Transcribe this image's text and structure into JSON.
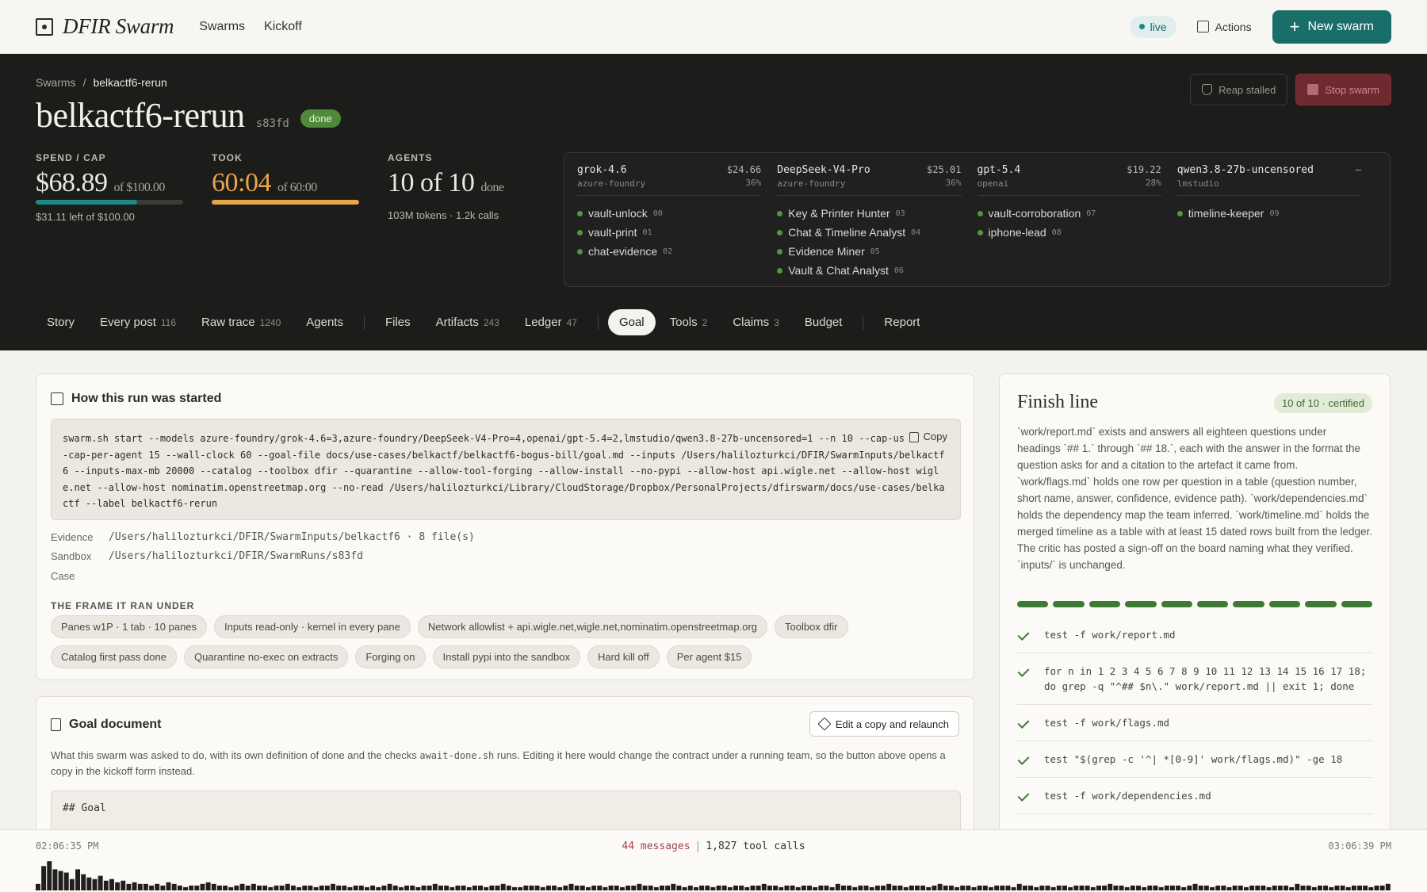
{
  "nav": {
    "brand": "DFIR Swarm",
    "links": [
      "Swarms",
      "Kickoff"
    ],
    "live": "live",
    "actions": "Actions",
    "new_swarm": "New swarm"
  },
  "hero": {
    "crumb_root": "Swarms",
    "crumb_sep": "/",
    "crumb_current": "belkactf6-rerun",
    "title": "belkactf6-rerun",
    "id": "s83fd",
    "status": "done",
    "reap": "Reap stalled",
    "stop": "Stop swarm",
    "spend": {
      "label": "SPEND / CAP",
      "value": "$68.89",
      "of": "of $100.00",
      "sub": "$31.11 left of $100.00",
      "fraction": 0.689
    },
    "took": {
      "label": "TOOK",
      "value": "60:04",
      "of": "of 60:00",
      "fraction": 1.0
    },
    "agents": {
      "label": "AGENTS",
      "value": "10 of 10",
      "of": "done",
      "sub": "103M tokens · 1.2k calls"
    }
  },
  "models": [
    {
      "name": "grok-4.6",
      "provider": "azure-foundry",
      "cost": "$24.66",
      "pct": "36%",
      "agents": [
        {
          "name": "vault-unlock",
          "n": "00"
        },
        {
          "name": "vault-print",
          "n": "01"
        },
        {
          "name": "chat-evidence",
          "n": "02"
        }
      ]
    },
    {
      "name": "DeepSeek-V4-Pro",
      "provider": "azure-foundry",
      "cost": "$25.01",
      "pct": "36%",
      "agents": [
        {
          "name": "Key & Printer Hunter",
          "n": "03"
        },
        {
          "name": "Chat & Timeline Analyst",
          "n": "04"
        },
        {
          "name": "Evidence Miner",
          "n": "05"
        },
        {
          "name": "Vault & Chat Analyst",
          "n": "06"
        }
      ]
    },
    {
      "name": "gpt-5.4",
      "provider": "openai",
      "cost": "$19.22",
      "pct": "28%",
      "agents": [
        {
          "name": "vault-corroboration",
          "n": "07"
        },
        {
          "name": "iphone-lead",
          "n": "08"
        }
      ]
    },
    {
      "name": "qwen3.8-27b-uncensored",
      "provider": "lmstudio",
      "cost": "–",
      "pct": "",
      "agents": [
        {
          "name": "timeline-keeper",
          "n": "09"
        }
      ]
    }
  ],
  "tabs": [
    {
      "label": "Story",
      "count": ""
    },
    {
      "label": "Every post",
      "count": "116"
    },
    {
      "label": "Raw trace",
      "count": "1240"
    },
    {
      "label": "Agents",
      "count": ""
    },
    {
      "sep": true
    },
    {
      "label": "Files",
      "count": ""
    },
    {
      "label": "Artifacts",
      "count": "243"
    },
    {
      "label": "Ledger",
      "count": "47"
    },
    {
      "sep": true
    },
    {
      "label": "Goal",
      "count": "",
      "active": true
    },
    {
      "label": "Tools",
      "count": "2"
    },
    {
      "label": "Claims",
      "count": "3"
    },
    {
      "label": "Budget",
      "count": ""
    },
    {
      "sep": true
    },
    {
      "label": "Report",
      "count": ""
    }
  ],
  "started": {
    "title": "How this run was started",
    "copy": "Copy",
    "command": "swarm.sh start --models azure-foundry/grok-4.6=3,azure-foundry/DeepSeek-V4-Pro=4,openai/gpt-5.4=2,lmstudio/qwen3.8-27b-uncensored=1 --n 10 --cap-usd 100 --cap-per-agent 15 --wall-clock 60 --goal-file docs/use-cases/belkactf/belkactf6-bogus-bill/goal.md --inputs /Users/halilozturkci/DFIR/SwarmInputs/belkactf6 --inputs-max-mb 20000 --catalog --toolbox dfir --quarantine --allow-tool-forging --allow-install --no-pypi --allow-host api.wigle.net --allow-host wigle.net --allow-host nominatim.openstreetmap.org --no-read /Users/halilozturkci/Library/CloudStorage/Dropbox/PersonalProjects/dfirswarm/docs/use-cases/belkactf --label belkactf6-rerun",
    "evidence_label": "Evidence",
    "evidence_value": "/Users/halilozturkci/DFIR/SwarmInputs/belkactf6 · 8 file(s)",
    "sandbox_label": "Sandbox",
    "sandbox_value": "/Users/halilozturkci/DFIR/SwarmRuns/s83fd",
    "case_label": "Case",
    "frame_label": "THE FRAME IT RAN UNDER",
    "chips": [
      "Panes w1P · 1 tab · 10 panes",
      "Inputs read-only · kernel in every pane",
      "Network allowlist + api.wigle.net,wigle.net,nominatim.openstreetmap.org",
      "Toolbox dfir",
      "Catalog first pass done",
      "Quarantine no-exec on extracts",
      "Forging on",
      "Install pypi into the sandbox",
      "Hard kill off",
      "Per agent $15"
    ]
  },
  "goal": {
    "title": "Goal document",
    "edit": "Edit a copy and relaunch",
    "desc_a": "What this swarm was asked to do, with its own definition of done and the checks ",
    "desc_code": "await-done.sh",
    "desc_b": " runs. Editing it here would change the contract under a running team, so the button above opens a copy in the kickoff form instead.",
    "body": "## Goal"
  },
  "finish": {
    "title": "Finish line",
    "cert": "10 of 10 · certified",
    "desc": "`work/report.md` exists and answers all eighteen questions under headings `## 1.` through `## 18.`, each with the answer in the format the question asks for and a citation to the artefact it came from. `work/flags.md` holds one row per question in a table (question number, short name, answer, confidence, evidence path). `work/dependencies.md` holds the dependency map the team inferred. `work/timeline.md` holds the merged timeline as a table with at least 15 dated rows built from the ledger. The critic has posted a sign-off on the board naming what they verified. `inputs/` is unchanged.",
    "segments_done": 10,
    "segments_total": 10,
    "checks": [
      "test -f work/report.md",
      "for n in 1 2 3 4 5 6 7 8 9 10 11 12 13 14 15 16 17 18; do grep -q \"^## $n\\.\" work/report.md || exit 1; done",
      "test -f work/flags.md",
      "test \"$(grep -c '^| *[0-9]' work/flags.md)\" -ge 18",
      "test -f work/dependencies.md"
    ]
  },
  "timeline": {
    "start": "02:06:35 PM",
    "end": "03:06:39 PM",
    "messages": "44 messages",
    "sep": "|",
    "tools": "1,827 tool calls",
    "bars": [
      8,
      30,
      36,
      26,
      24,
      22,
      14,
      26,
      20,
      16,
      14,
      18,
      12,
      14,
      10,
      12,
      8,
      10,
      8,
      8,
      6,
      8,
      6,
      10,
      8,
      6,
      4,
      6,
      6,
      8,
      10,
      8,
      6,
      6,
      4,
      6,
      8,
      6,
      8,
      6,
      6,
      4,
      6,
      6,
      8,
      6,
      4,
      6,
      6,
      4,
      6,
      6,
      8,
      6,
      6,
      4,
      6,
      6,
      4,
      6,
      4,
      6,
      8,
      6,
      4,
      6,
      6,
      4,
      6,
      6,
      8,
      6,
      6,
      4,
      6,
      6,
      4,
      6,
      6,
      4,
      6,
      6,
      8,
      6,
      4,
      4,
      6,
      6,
      6,
      4,
      6,
      6,
      4,
      6,
      8,
      6,
      6,
      4,
      6,
      6,
      4,
      6,
      6,
      4,
      6,
      6,
      8,
      6,
      6,
      4,
      6,
      6,
      8,
      6,
      4,
      6,
      4,
      6,
      6,
      4,
      6,
      6,
      4,
      6,
      6,
      4,
      6,
      6,
      8,
      6,
      6,
      4,
      6,
      6,
      4,
      6,
      6,
      4,
      6,
      6,
      4,
      8,
      6,
      6,
      4,
      6,
      6,
      4,
      6,
      6,
      8,
      6,
      6,
      4,
      6,
      6,
      6,
      4,
      6,
      8,
      6,
      6,
      4,
      6,
      6,
      4,
      6,
      6,
      4,
      6,
      6,
      6,
      4,
      8,
      6,
      6,
      4,
      6,
      6,
      4,
      6,
      6,
      4,
      6,
      6,
      6,
      4,
      6,
      6,
      8,
      6,
      6,
      4,
      6,
      6,
      4,
      6,
      6,
      4,
      6,
      6,
      6,
      4,
      6,
      8,
      6,
      6,
      4,
      6,
      6,
      4,
      6,
      6,
      4,
      6,
      6,
      6,
      4,
      6,
      6,
      6,
      4,
      8,
      6,
      6,
      4,
      6,
      6,
      4,
      6,
      6,
      4,
      6,
      6,
      6,
      4,
      6,
      6,
      8
    ]
  }
}
